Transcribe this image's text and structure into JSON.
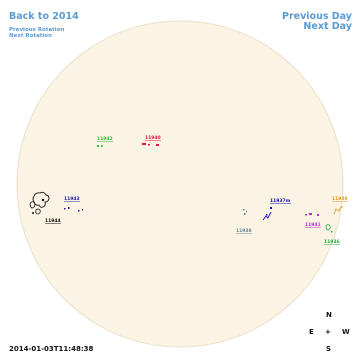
{
  "nav": {
    "back_label": "Back to 2014",
    "prev_rotation_label": "Previous Rotation",
    "next_rotation_label": "Next Rotation",
    "prev_day_label": "Previous Day",
    "next_day_label": "Next Day"
  },
  "timestamp": "2014-01-03T11:48:38",
  "compass": {
    "north": "N",
    "south": "S",
    "east": "E",
    "west": "W",
    "center": "+"
  },
  "colors": {
    "disk": "#fbf3e4",
    "disk_edge": "#ebe0cc",
    "link": "#5b9bd5"
  },
  "regions": [
    {
      "id": "11942",
      "label": "11942",
      "color": "#2fbf3a"
    },
    {
      "id": "11940",
      "label": "11940",
      "color": "#e0143c"
    },
    {
      "id": "11943",
      "label": "11943",
      "color": "#2020a0"
    },
    {
      "id": "11944",
      "label": "11944",
      "color": "#111111"
    },
    {
      "id": "11937",
      "label": "11937m",
      "color": "#1414b4"
    },
    {
      "id": "11938",
      "label": "11938",
      "color": "#6a8a9a"
    },
    {
      "id": "11941",
      "label": "11941",
      "color": "#b030c8"
    },
    {
      "id": "11939",
      "label": "11939",
      "color": "#e89a1c"
    },
    {
      "id": "11936",
      "label": "11936",
      "color": "#1fae3c"
    }
  ]
}
